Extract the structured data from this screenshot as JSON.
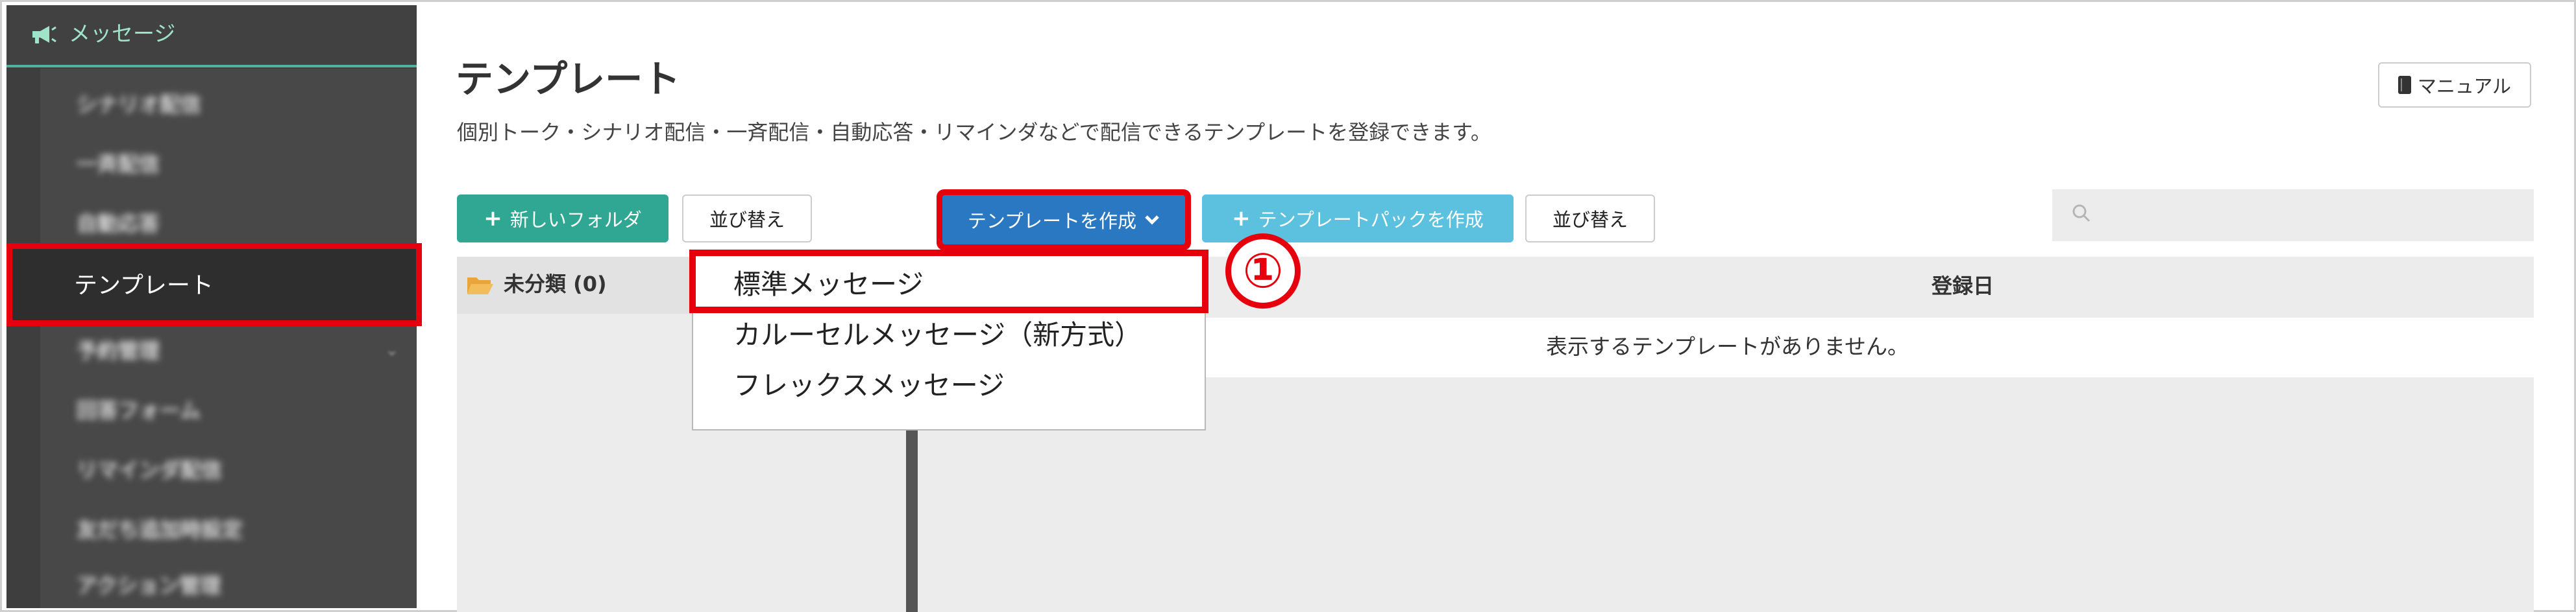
{
  "sidebar": {
    "header": {
      "label": "メッセージ",
      "icon": "megaphone-icon"
    },
    "items": [
      {
        "label": "シナリオ配信",
        "blurred": true
      },
      {
        "label": "一斉配信",
        "blurred": true
      },
      {
        "label": "自動応答",
        "blurred": true
      },
      {
        "label": "テンプレート",
        "active": true
      },
      {
        "label": "予約管理",
        "blurred": true
      },
      {
        "label": "回答フォーム",
        "blurred": true
      },
      {
        "label": "リマインダ配信",
        "blurred": true
      },
      {
        "label": "友だち追加時設定",
        "blurred": true
      },
      {
        "label": "アクション管理",
        "blurred": true
      }
    ]
  },
  "header": {
    "title": "テンプレート",
    "description": "個別トーク・シナリオ配信・一斉配信・自動応答・リマインダなどで配信できるテンプレートを登録できます。",
    "manual_label": "マニュアル"
  },
  "toolbar": {
    "new_folder_label": "新しいフォルダ",
    "sort_label_1": "並び替え",
    "create_template_label": "テンプレートを作成",
    "template_pack_label": "テンプレートパックを作成",
    "sort_label_2": "並び替え",
    "search_placeholder": ""
  },
  "folders": [
    {
      "label": "未分類 (0)"
    }
  ],
  "table": {
    "date_header": "登録日",
    "empty_message": "表示するテンプレートがありません。"
  },
  "dropdown": {
    "items": [
      "標準メッセージ",
      "カルーセルメッセージ（新方式）",
      "フレックスメッセージ"
    ]
  },
  "annotation": {
    "step": "①"
  },
  "colors": {
    "accent_green": "#2fa792",
    "create_blue": "#2b78c2",
    "pack_cyan": "#5bc1de",
    "highlight_red": "#e6000e",
    "sidebar_bg": "#3e3e3e"
  }
}
